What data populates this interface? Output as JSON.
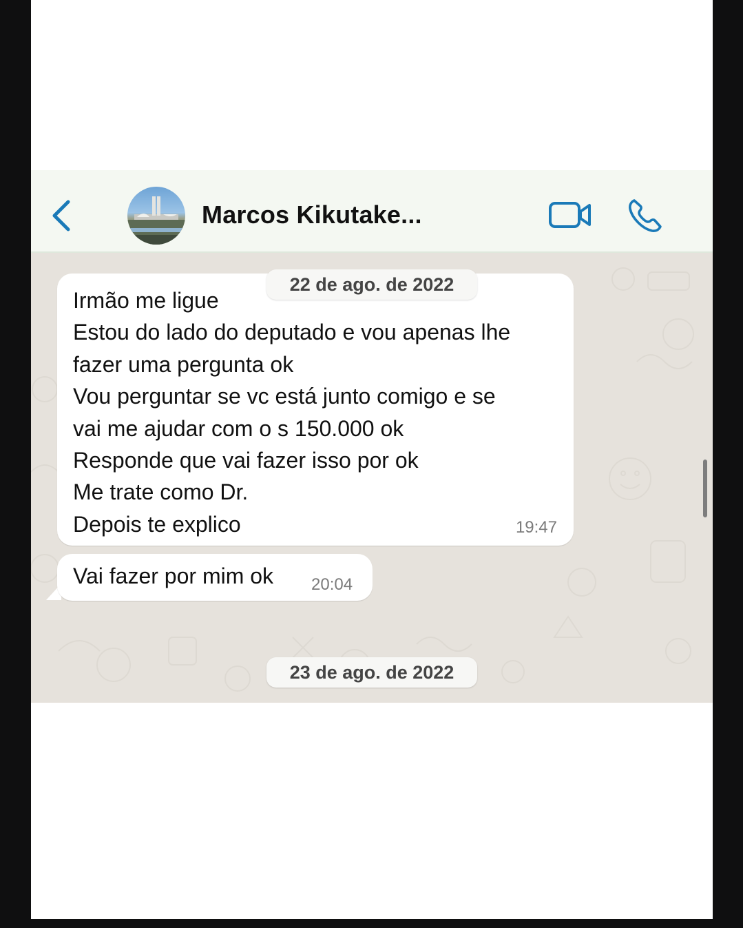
{
  "header": {
    "contact_name": "Marcos Kikutake...",
    "icons": [
      "back-chevron-icon",
      "video-camera-icon",
      "phone-icon"
    ],
    "accent_color": "#1a7ab8"
  },
  "messages": [
    {
      "lines": [
        "Irmão me ligue",
        "Estou do lado do deputado e vou apenas lhe",
        "fazer uma pergunta ok",
        "Vou perguntar se vc está junto comigo e se",
        "vai me ajudar com o s 150.000 ok",
        "Responde que vai fazer isso por ok",
        "Me trate como Dr.",
        "Depois te explico"
      ],
      "time": "19:47"
    },
    {
      "text": "Vai fazer por mim ok",
      "time": "20:04"
    }
  ],
  "date_separators": [
    "22 de ago. de 2022",
    "23 de ago. de 2022"
  ]
}
